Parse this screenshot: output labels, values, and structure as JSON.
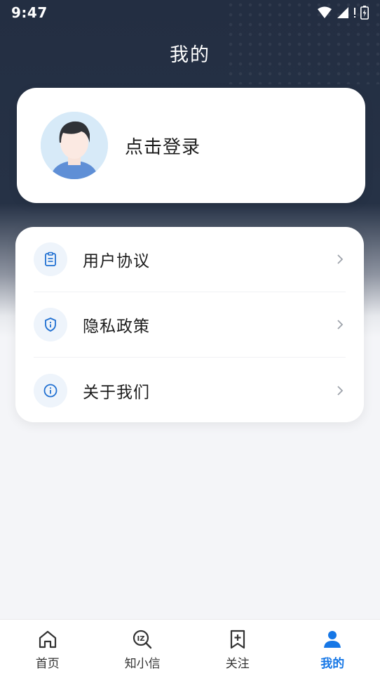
{
  "status_bar": {
    "time": "9:47"
  },
  "header": {
    "title": "我的"
  },
  "profile": {
    "login_label": "点击登录"
  },
  "menu": {
    "items": [
      {
        "label": "用户协议",
        "icon": "clipboard-icon"
      },
      {
        "label": "隐私政策",
        "icon": "shield-info-icon"
      },
      {
        "label": "关于我们",
        "icon": "info-circle-icon"
      }
    ]
  },
  "tab_bar": {
    "tabs": [
      {
        "label": "首页",
        "icon": "home-icon",
        "active": false
      },
      {
        "label": "知小信",
        "icon": "search-chat-icon",
        "active": false
      },
      {
        "label": "关注",
        "icon": "bookmark-plus-icon",
        "active": false
      },
      {
        "label": "我的",
        "icon": "person-icon",
        "active": true
      }
    ]
  },
  "colors": {
    "header_bg": "#232e42",
    "accent": "#1677e6",
    "icon_bg": "#eef4fb",
    "page_bg": "#f4f5f8"
  }
}
